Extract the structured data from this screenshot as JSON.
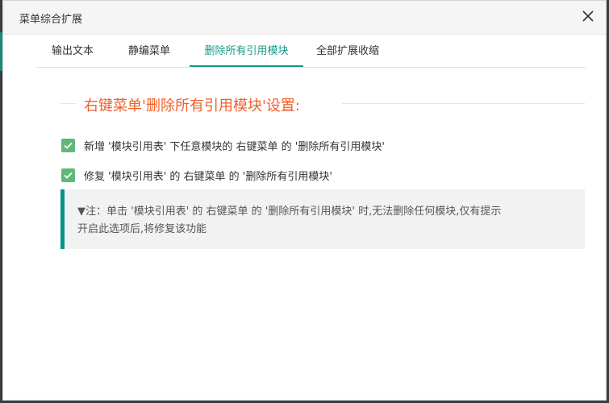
{
  "dialog": {
    "title": "菜单综合扩展",
    "close_icon": "close-icon"
  },
  "tabs": [
    {
      "label": "输出文本",
      "active": false
    },
    {
      "label": "静编菜单",
      "active": false
    },
    {
      "label": "删除所有引用模块",
      "active": true
    },
    {
      "label": "全部扩展收缩",
      "active": false
    }
  ],
  "section": {
    "title": "右键菜单'删除所有引用模块'设置:"
  },
  "options": [
    {
      "label": "新增 '模块引用表' 下任意模块的 右键菜单 的 '删除所有引用模块'",
      "checked": true
    },
    {
      "label": "修复 '模块引用表' 的 右键菜单 的 '删除所有引用模块'",
      "checked": true
    }
  ],
  "note": {
    "line1": "▼注：单击 '模块引用表' 的 右键菜单 的 '删除所有引用模块' 时,无法删除任何模块,仅有提示",
    "line2": "开启此选项后,将修复该功能"
  },
  "colors": {
    "accent": "#159a8c",
    "section_title": "#f05f2a",
    "checkbox": "#5fb878",
    "note_border": "#009688"
  }
}
